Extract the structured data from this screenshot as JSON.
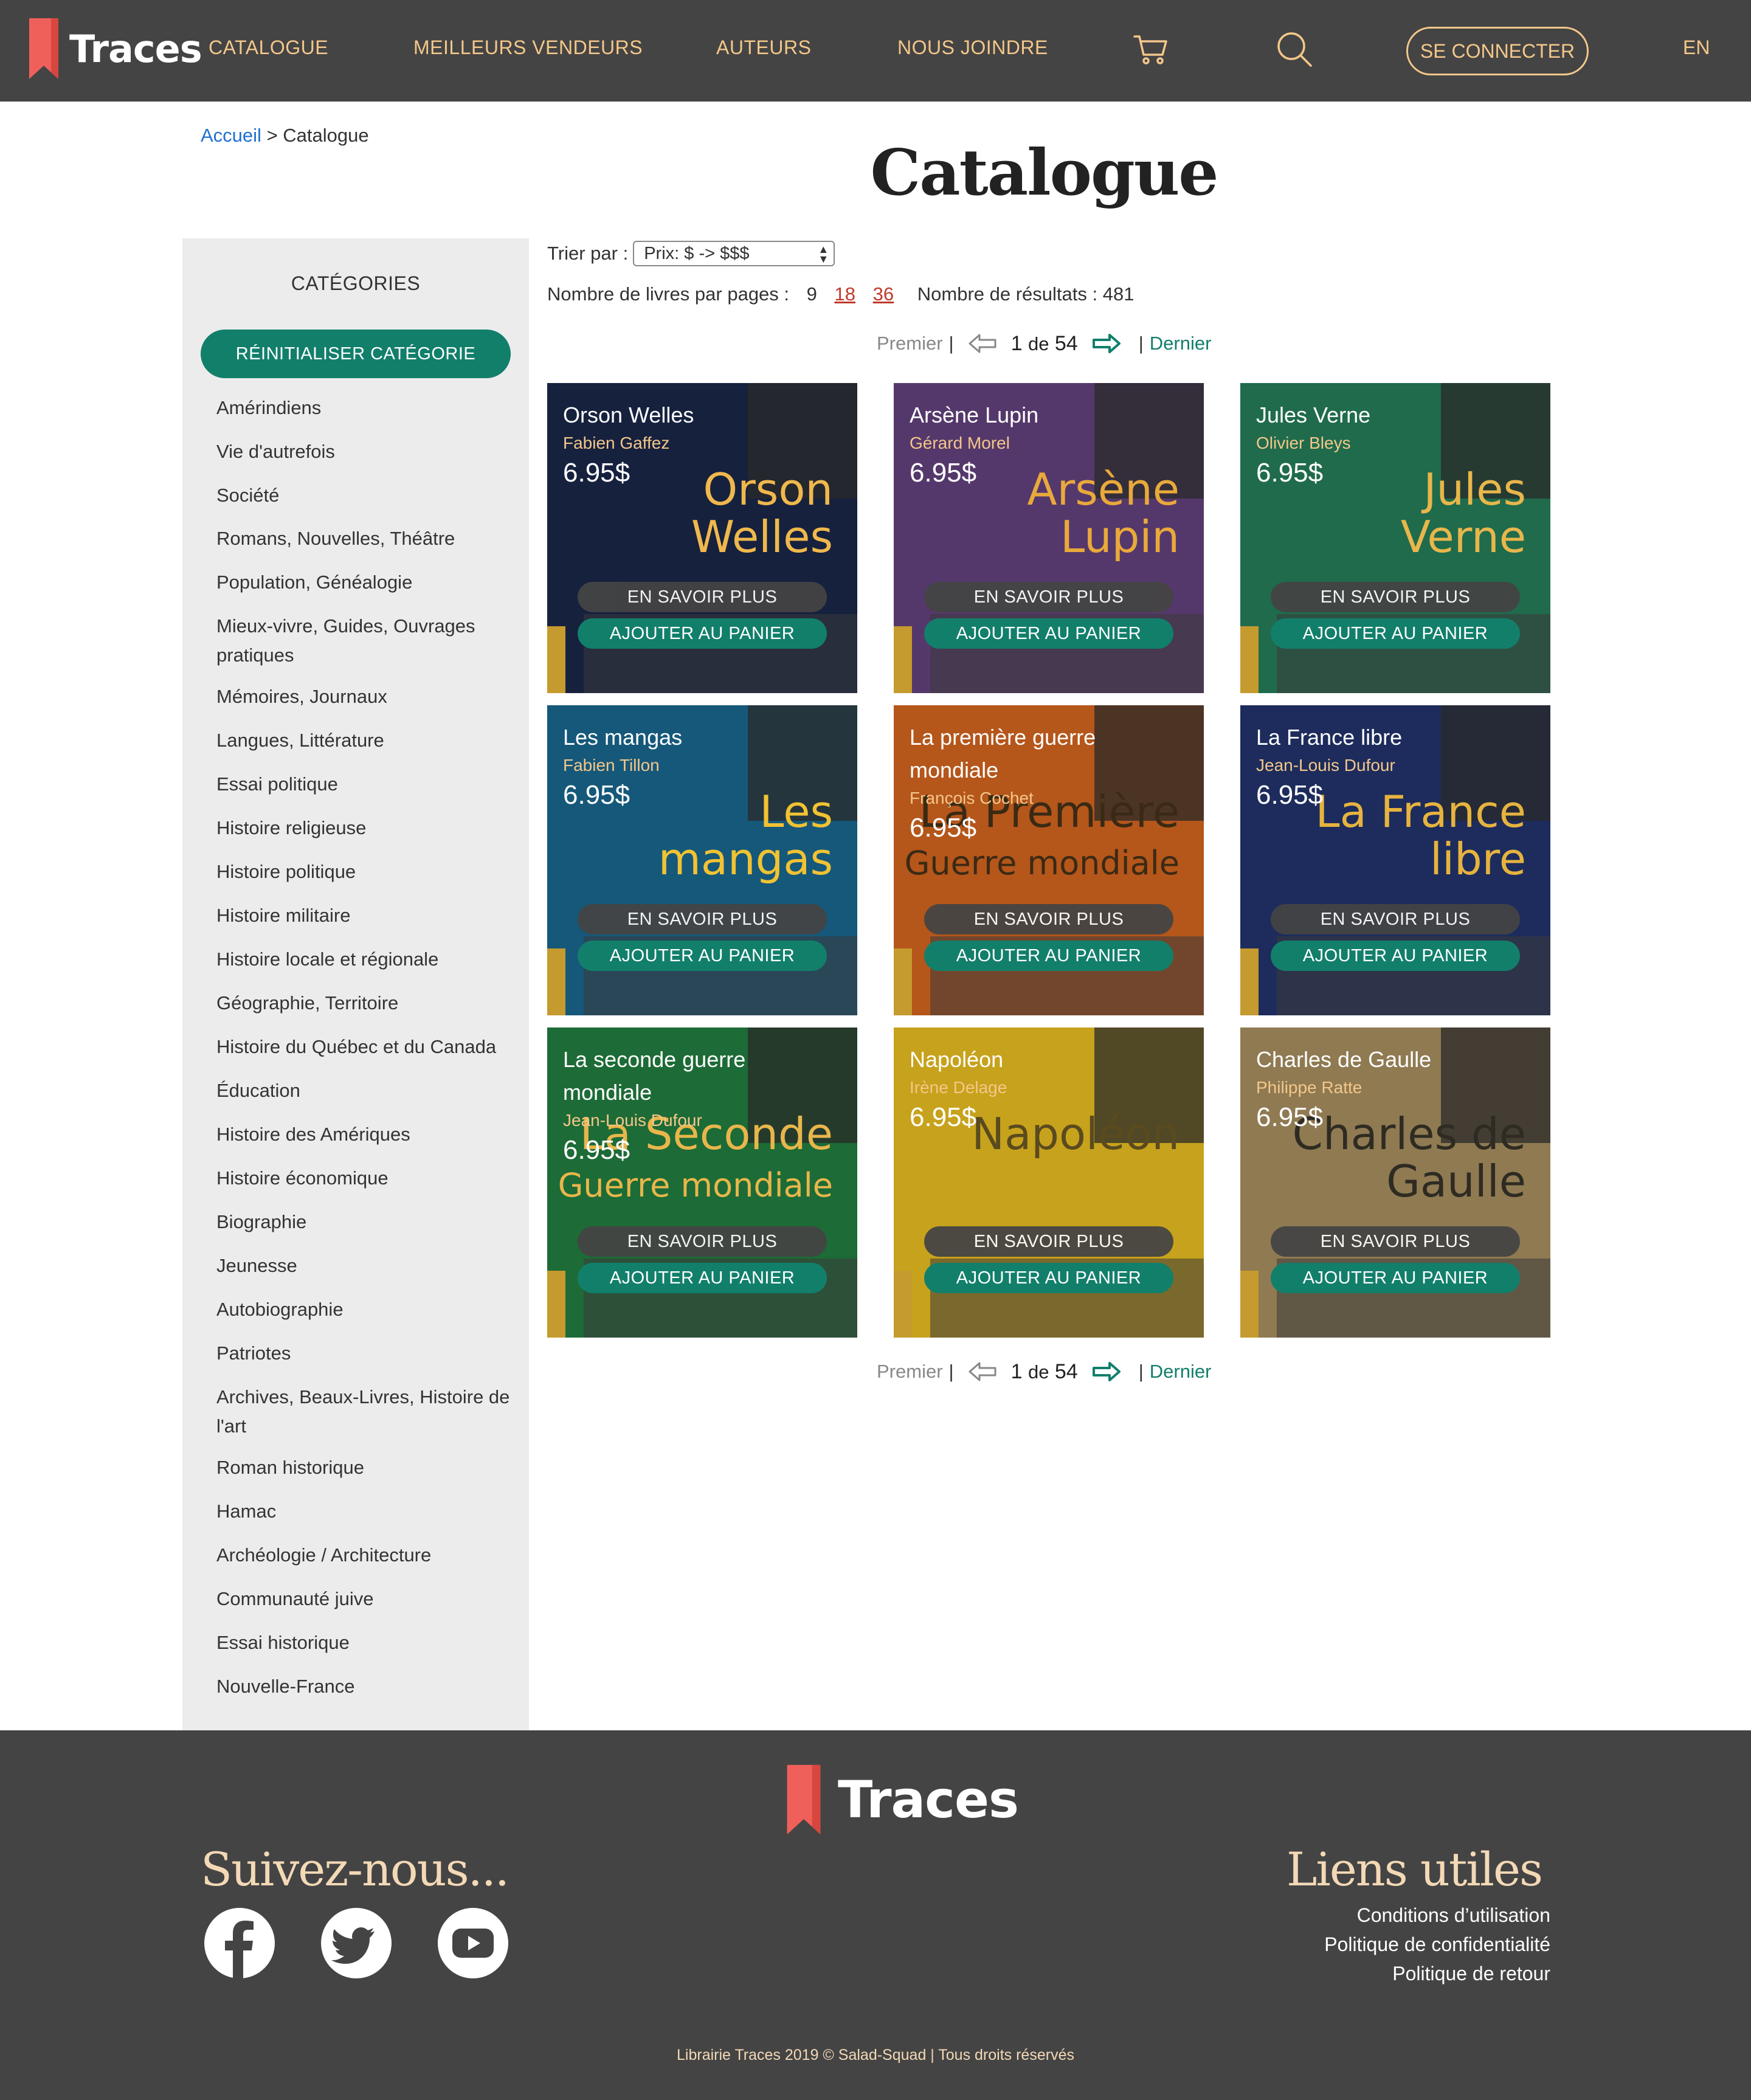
{
  "header": {
    "logo_text": "Traces",
    "nav": [
      "CATALOGUE",
      "MEILLEURS VENDEURS",
      "AUTEURS",
      "NOUS JOINDRE"
    ],
    "login_label": "SE CONNECTER",
    "lang_label": "EN",
    "icons": [
      "cart-icon",
      "search-icon"
    ]
  },
  "breadcrumb": {
    "home": "Accueil",
    "separator": ">",
    "current": "Catalogue"
  },
  "page_title": "Catalogue",
  "sidebar": {
    "title": "CATÉGORIES",
    "reset_label": "RÉINITIALISER CATÉGORIE",
    "categories": [
      "Amérindiens",
      "Vie d'autrefois",
      "Société",
      "Romans, Nouvelles, Théâtre",
      "Population, Généalogie",
      "Mieux-vivre, Guides, Ouvrages pratiques",
      "Mémoires, Journaux",
      "Langues, Littérature",
      "Essai politique",
      "Histoire religieuse",
      "Histoire politique",
      "Histoire militaire",
      "Histoire locale et régionale",
      "Géographie, Territoire",
      "Histoire du Québec et du Canada",
      "Éducation",
      "Histoire des Amériques",
      "Histoire économique",
      "Biographie",
      "Jeunesse",
      "Autobiographie",
      "Patriotes",
      "Archives, Beaux-Livres, Histoire de l'art",
      "Roman historique",
      "Hamac",
      "Archéologie / Architecture",
      "Communauté juive",
      "Essai historique",
      "Nouvelle-France"
    ]
  },
  "sort": {
    "label": "Trier par :",
    "selected": "Prix: $ -> $$$"
  },
  "per_page": {
    "label": "Nombre de livres par pages :",
    "options": [
      "9",
      "18",
      "36"
    ],
    "results_label": "Nombre de résultats :",
    "results_count": "481"
  },
  "pager": {
    "first": "Premier",
    "sep": "|",
    "page": "1",
    "of": "de",
    "total": "54",
    "last": "Dernier"
  },
  "card_buttons": {
    "more": "EN SAVOIR PLUS",
    "cart": "AJOUTER AU PANIER"
  },
  "books": [
    {
      "title": "Orson Welles",
      "author": "Fabien Gaffez",
      "price": "6.95$",
      "cover_text": "Orson Welles",
      "bg": "#16213e",
      "accent": "#f0b84c"
    },
    {
      "title": "Arsène Lupin",
      "author": "Gérard Morel",
      "price": "6.95$",
      "cover_text": "Arsène Lupin",
      "bg": "#55386b",
      "accent": "#e9a93b"
    },
    {
      "title": "Jules Verne",
      "author": "Olivier Bleys",
      "price": "6.95$",
      "cover_text": "Jules Verne",
      "bg": "#1f6b4c",
      "accent": "#e8b64b"
    },
    {
      "title": "Les mangas",
      "author": "Fabien Tillon",
      "price": "6.95$",
      "cover_text": "Les mangas",
      "bg": "#15587a",
      "accent": "#f1c233"
    },
    {
      "title": "La première guerre mondiale",
      "author": "François Cochet",
      "price": "6.95$",
      "cover_text": "La Première Guerre mondiale",
      "bg": "#b5561b",
      "accent": "#3a2a14"
    },
    {
      "title": "La France libre",
      "author": "Jean-Louis Dufour",
      "price": "6.95$",
      "cover_text": "La France libre",
      "bg": "#1d2c5c",
      "accent": "#e6b33e"
    },
    {
      "title": "La seconde guerre mondiale",
      "author": "Jean-Louis Dufour",
      "price": "6.95$",
      "cover_text": "La Seconde Guerre mondiale",
      "bg": "#1d6b36",
      "accent": "#e8b64b"
    },
    {
      "title": "Napoléon",
      "author": "Irène Delage",
      "price": "6.95$",
      "cover_text": "Napoléon",
      "bg": "#c7a21c",
      "accent": "#5a4a1f"
    },
    {
      "title": "Charles de Gaulle",
      "author": "Philippe Ratte",
      "price": "6.95$",
      "cover_text": "Charles de Gaulle",
      "bg": "#8f7a52",
      "accent": "#2e2b22"
    }
  ],
  "footer": {
    "logo_text": "Traces",
    "follow_title": "Suivez-nous...",
    "links_title": "Liens utiles",
    "links": [
      "Conditions d’utilisation",
      "Politique de confidentialité",
      "Politique de retour"
    ],
    "social": [
      "facebook-icon",
      "twitter-icon",
      "youtube-icon"
    ],
    "copyright": "Librairie Traces 2019 © Salad-Squad | Tous droits réservés"
  },
  "colors": {
    "header_bg": "#444444",
    "accent_gold": "#f4c78a",
    "teal": "#127f6b",
    "logo_red": "#f0605a",
    "link_blue": "#1f6fd0",
    "page_link_red": "#c0392b"
  }
}
